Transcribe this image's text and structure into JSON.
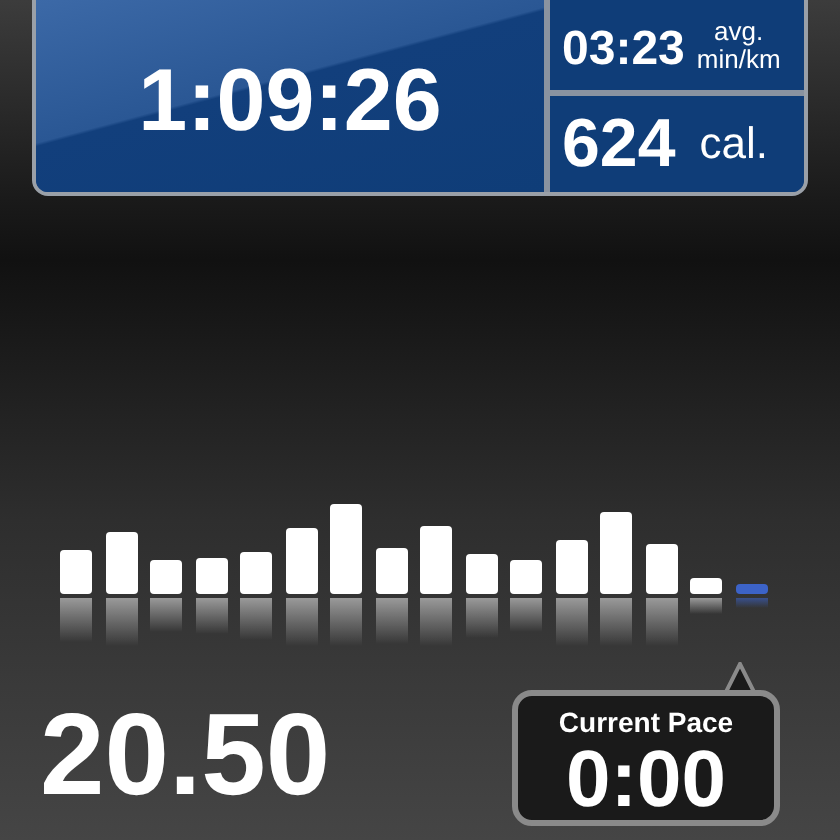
{
  "elapsed_time": "1:09:26",
  "pace": {
    "value": "03:23",
    "label_top": "avg.",
    "label_bottom": "min/km"
  },
  "calories": {
    "value": "624",
    "unit": "cal."
  },
  "distance": "20.50",
  "current_pace": {
    "label": "Current Pace",
    "value": "0:00"
  }
}
